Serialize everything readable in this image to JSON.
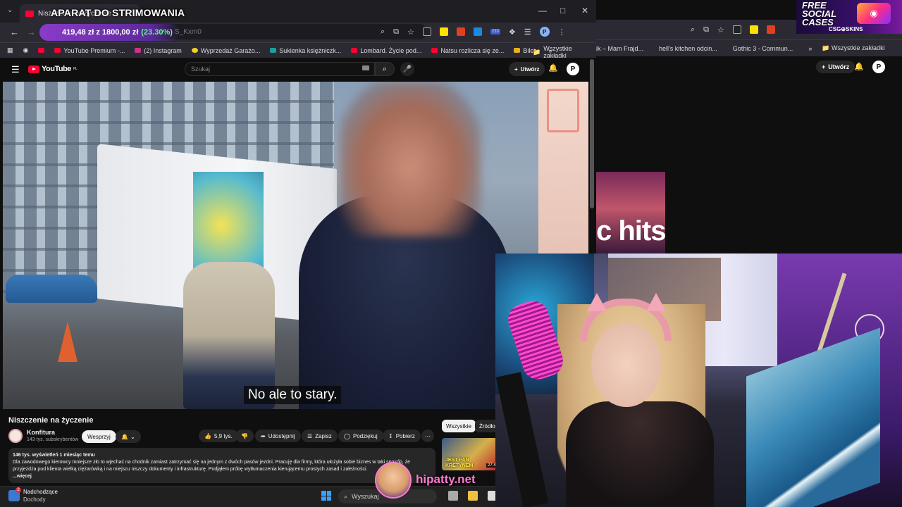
{
  "overlay": {
    "stream_title": "APARAT DO STRIMOWANIA",
    "money_current": "419,48 zł",
    "money_sep": "z",
    "money_target": "1800,00 zł",
    "money_pct": "(23.30%)",
    "streamer_handle": "hipatty.net"
  },
  "promo": {
    "title": "FREE SOCIAL CASES",
    "subtitle": "CSG⊕SKINS"
  },
  "browser": {
    "tab_title": "Niszczenie na życzenie",
    "url_fragment": "S_Kxm0",
    "bookmarks": [
      {
        "label": "YouTube Premium -..."
      },
      {
        "label": "(2) Instagram"
      },
      {
        "label": "Wyprzedaż Garażo..."
      },
      {
        "label": "Sukienka księżniczk..."
      },
      {
        "label": "Lombard. Życie pod..."
      },
      {
        "label": "Natsu rozlicza się ze..."
      },
      {
        "label": "Bilety"
      }
    ],
    "bookmarks_folder": "Wszystkie zakładki",
    "ext_badge": "233"
  },
  "bg_browser": {
    "bookmarks": [
      "ik – Mam Frajd...",
      "hell's kitchen odcin...",
      "Gothic 3 - Commun..."
    ],
    "bookmarks_folder": "Wszystkie zakładki",
    "create_label": "Utwórz",
    "thumb_text": "c hits"
  },
  "youtube": {
    "logo": "YouTube",
    "logo_region": "PL",
    "search_placeholder": "Szukaj",
    "create_label": "Utwórz",
    "avatar_letter": "P",
    "subtitle": "No ale to stary.",
    "video_title": "Niszczenie na życzenie",
    "channel_name": "Konfitura",
    "channel_subs": "143 tys. subskrybentów",
    "support_label": "Wesprzyj",
    "actions": {
      "likes": "5,9 tys.",
      "share": "Udostępnij",
      "save": "Zapisz",
      "thanks": "Podziękuj",
      "download": "Pobierz"
    },
    "description": {
      "meta": "146 tys. wyświetleń  1 miesiąc temu",
      "text": "Dla zawodowego kierowcy mniejsze zło to wjechać na chodnik zamiast zatrzymać się na jednym z dwóch pasów jezdni. Pracuję dla firmy, która ułożyła sobie biznes w taki sposób, że przyjeżdża pod klienta wielką ciężarówką i na miejscu niszczy dokumenty i infrastrukturę. Podjąłem próbę wytłumaczenia kierującemu prostych zasad i zależności.",
      "more": "...więcej"
    },
    "chips": [
      "Wszystkie",
      "Źródło"
    ],
    "rec_caption": "JEST PAN KRETYNEM",
    "rec_duration": "27:4"
  },
  "taskbar": {
    "weather_title": "Nadchodzące",
    "weather_sub": "Dochody",
    "weather_badge": "2",
    "search_label": "Wyszukaj"
  },
  "colors": {
    "yt_red": "#ff0033",
    "overlay_purple": "#8a3cc8",
    "pct_green": "#5cff8a",
    "handle_pink": "#ff7ad0"
  }
}
